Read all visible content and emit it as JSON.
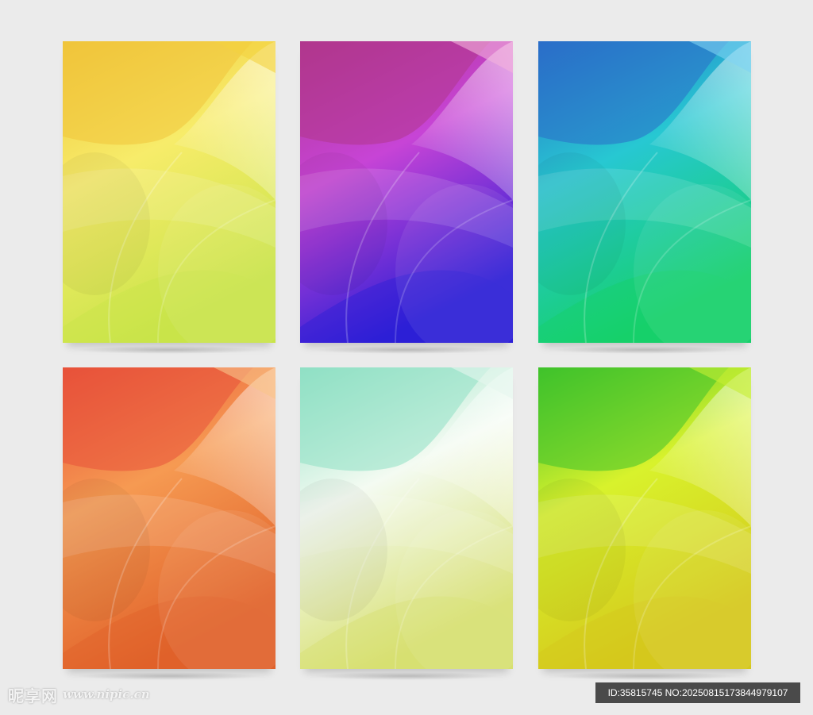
{
  "cards": [
    {
      "id": "yellow",
      "top": "#f0c43a",
      "mid": "#f7ec6a",
      "bottom": "#c9e44a",
      "accent": "#f3d23f"
    },
    {
      "id": "purple",
      "top": "#b0378d",
      "mid": "#c744d6",
      "bottom": "#2d1fd6",
      "accent": "#f3b2dc"
    },
    {
      "id": "blue",
      "top": "#2a6ec9",
      "mid": "#27c8d2",
      "bottom": "#16d06a",
      "accent": "#7ed4f3"
    },
    {
      "id": "orange",
      "top": "#e8523a",
      "mid": "#f69a52",
      "bottom": "#e0622a",
      "accent": "#f9c48a"
    },
    {
      "id": "mint",
      "top": "#8fe0c4",
      "mid": "#f4fbf2",
      "bottom": "#d8e072",
      "accent": "#e6f6ee"
    },
    {
      "id": "green",
      "top": "#3fc22b",
      "mid": "#d8f22c",
      "bottom": "#d5c81c",
      "accent": "#c6ef34"
    }
  ],
  "watermark": {
    "brand": "昵享网",
    "url": "www.nipic.cn",
    "id_text": "ID:35815745 NO:20250815173844979107"
  }
}
